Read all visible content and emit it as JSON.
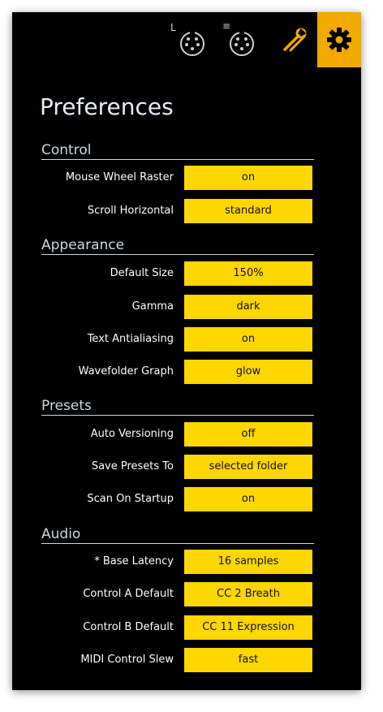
{
  "toolbar": {
    "midi_l_tag": "L",
    "midi_e_tag": "≡",
    "accent": "#f2a900",
    "icons": [
      "midi-l-icon",
      "midi-e-icon",
      "tools-icon",
      "gear-icon"
    ]
  },
  "title": "Preferences",
  "colors": {
    "value_bg": "#ffd600",
    "panel_bg": "#000000",
    "section": "#cdd7e3"
  },
  "sections": {
    "control": {
      "title": "Control",
      "rows": [
        {
          "label": "Mouse Wheel Raster",
          "value": "on"
        },
        {
          "label": "Scroll Horizontal",
          "value": "standard"
        }
      ]
    },
    "appearance": {
      "title": "Appearance",
      "rows": [
        {
          "label": "Default Size",
          "value": "150%"
        },
        {
          "label": "Gamma",
          "value": "dark"
        },
        {
          "label": "Text Antialiasing",
          "value": "on"
        },
        {
          "label": "Wavefolder Graph",
          "value": "glow"
        }
      ]
    },
    "presets": {
      "title": "Presets",
      "rows": [
        {
          "label": "Auto Versioning",
          "value": "off"
        },
        {
          "label": "Save Presets To",
          "value": "selected folder"
        },
        {
          "label": "Scan On Startup",
          "value": "on"
        }
      ]
    },
    "audio": {
      "title": "Audio",
      "rows": [
        {
          "label": "* Base Latency",
          "value": "16 samples"
        },
        {
          "label": "Control A Default",
          "value": "CC 2 Breath"
        },
        {
          "label": "Control B Default",
          "value": "CC 11 Expression"
        },
        {
          "label": "MIDI Control Slew",
          "value": "fast"
        }
      ]
    }
  }
}
